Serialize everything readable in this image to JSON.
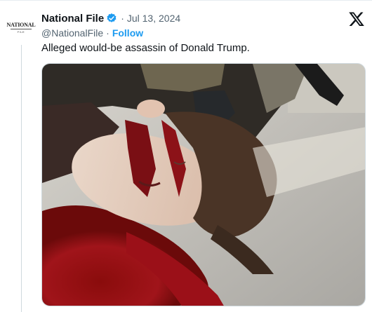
{
  "tweet": {
    "display_name": "National File",
    "separator_dot": "·",
    "date": "Jul 13, 2024",
    "handle": "@NationalFile",
    "handle_separator": "·",
    "follow_label": "Follow",
    "text": "Alleged would-be assassin of Donald Trump.",
    "avatar_logo": {
      "main": "NATIONAL",
      "sub": "FILE"
    }
  },
  "icons": {
    "verified": "verified-badge-icon",
    "platform": "x-logo-icon"
  },
  "colors": {
    "accent": "#1d9bf0",
    "text_primary": "#0f1419",
    "text_secondary": "#536471",
    "border": "#cfd9de"
  }
}
